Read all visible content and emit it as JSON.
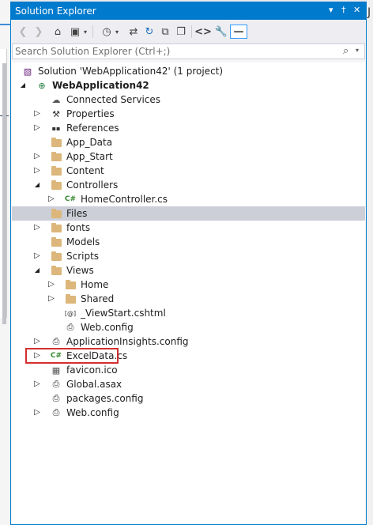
{
  "panel": {
    "title": "Solution Explorer",
    "controls": [
      "▾",
      "†",
      "✕"
    ]
  },
  "toolbar": {
    "icons": [
      "back-icon",
      "forward-icon",
      "home-icon",
      "switch-views-icon",
      "dropdown-icon",
      "history-icon",
      "dropdown-icon",
      "sync-icon",
      "refresh-icon",
      "collapse-all-icon",
      "show-all-files-icon",
      "view-code-icon",
      "properties-icon",
      "preview-icon"
    ]
  },
  "search": {
    "placeholder": "Search Solution Explorer (Ctrl+;)"
  },
  "right_glyph": "J",
  "tree": [
    {
      "label": "Solution 'WebApplication42' (1 project)",
      "icon": "solution",
      "indent": 0,
      "arrow": ""
    },
    {
      "label": "WebApplication42",
      "icon": "web-project",
      "indent": 1,
      "arrow": "expanded",
      "bold": true
    },
    {
      "label": "Connected Services",
      "icon": "connected",
      "indent": 2,
      "arrow": ""
    },
    {
      "label": "Properties",
      "icon": "wrench",
      "indent": 2,
      "arrow": "collapsed"
    },
    {
      "label": "References",
      "icon": "references",
      "indent": 2,
      "arrow": "collapsed"
    },
    {
      "label": "App_Data",
      "icon": "folder",
      "indent": 2,
      "arrow": ""
    },
    {
      "label": "App_Start",
      "icon": "folder",
      "indent": 2,
      "arrow": "collapsed"
    },
    {
      "label": "Content",
      "icon": "folder",
      "indent": 2,
      "arrow": "collapsed"
    },
    {
      "label": "Controllers",
      "icon": "folder",
      "indent": 2,
      "arrow": "expanded"
    },
    {
      "label": "HomeController.cs",
      "icon": "cs",
      "indent": 3,
      "arrow": "collapsed"
    },
    {
      "label": "Files",
      "icon": "folder",
      "indent": 2,
      "arrow": "",
      "selected": true
    },
    {
      "label": "fonts",
      "icon": "folder",
      "indent": 2,
      "arrow": "collapsed"
    },
    {
      "label": "Models",
      "icon": "folder",
      "indent": 2,
      "arrow": ""
    },
    {
      "label": "Scripts",
      "icon": "folder",
      "indent": 2,
      "arrow": "collapsed"
    },
    {
      "label": "Views",
      "icon": "folder",
      "indent": 2,
      "arrow": "expanded"
    },
    {
      "label": "Home",
      "icon": "folder",
      "indent": 3,
      "arrow": "collapsed"
    },
    {
      "label": "Shared",
      "icon": "folder",
      "indent": 3,
      "arrow": "collapsed"
    },
    {
      "label": "_ViewStart.cshtml",
      "icon": "cshtml",
      "indent": 3,
      "arrow": ""
    },
    {
      "label": "Web.config",
      "icon": "config",
      "indent": 3,
      "arrow": ""
    },
    {
      "label": "ApplicationInsights.config",
      "icon": "config",
      "indent": 2,
      "arrow": "collapsed"
    },
    {
      "label": "ExcelData.cs",
      "icon": "cs",
      "indent": 2,
      "arrow": "collapsed",
      "highlighted": true
    },
    {
      "label": "favicon.ico",
      "icon": "ico",
      "indent": 2,
      "arrow": ""
    },
    {
      "label": "Global.asax",
      "icon": "config",
      "indent": 2,
      "arrow": "collapsed"
    },
    {
      "label": "packages.config",
      "icon": "config",
      "indent": 2,
      "arrow": ""
    },
    {
      "label": "Web.config",
      "icon": "config",
      "indent": 2,
      "arrow": "collapsed"
    }
  ],
  "colors": {
    "titlebar": "#007acc",
    "selection": "#ccced8",
    "highlight_border": "#d32f2f",
    "folder": "#dcb67a",
    "csharp": "#388a34"
  }
}
